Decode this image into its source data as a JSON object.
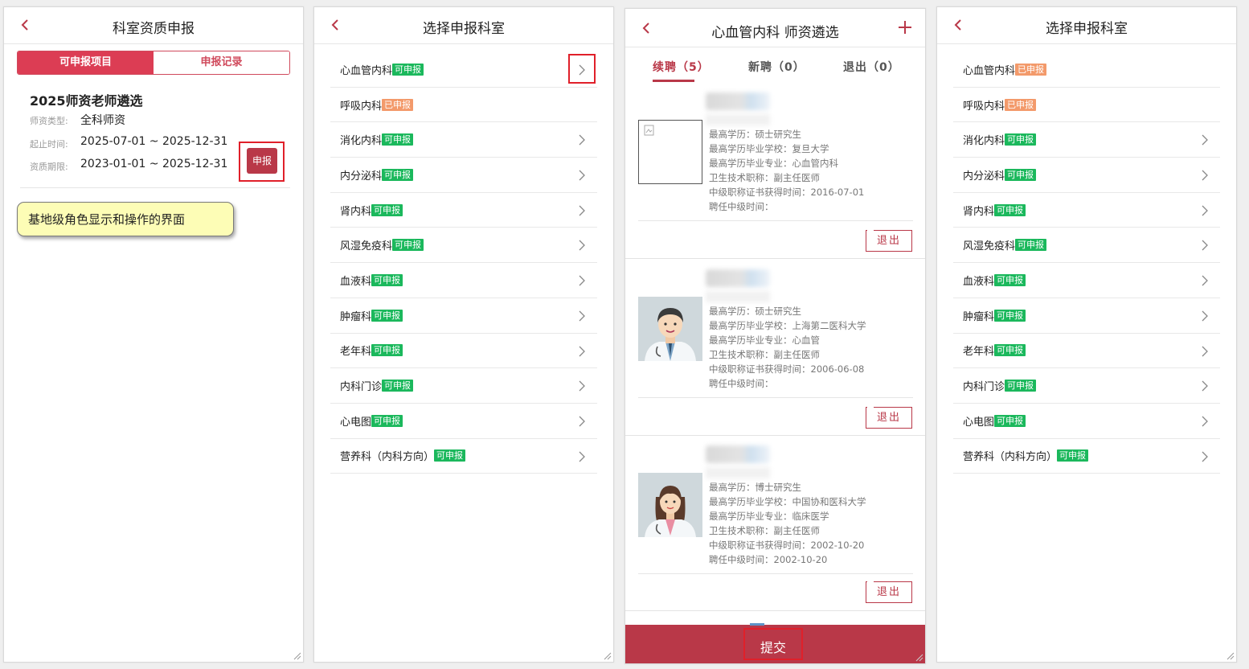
{
  "panel1": {
    "title": "科室资质申报",
    "tabs": [
      "可申报项目",
      "申报记录"
    ],
    "project": {
      "title": "2025师资老师遴选",
      "rows": [
        {
          "label": "师资类型:",
          "value": "全科师资"
        },
        {
          "label": "起止时间:",
          "value": "2025-07-01 ~ 2025-12-31"
        },
        {
          "label": "资质期限:",
          "value": "2023-01-01 ~ 2025-12-31"
        }
      ],
      "apply_label": "申报"
    },
    "note": "基地级角色显示和操作的界面"
  },
  "panel2": {
    "title": "选择申报科室",
    "items": [
      {
        "name": "心血管内科",
        "badge": "可申报",
        "status": "ok"
      },
      {
        "name": "呼吸内科",
        "badge": "已申报",
        "status": "done"
      },
      {
        "name": "消化内科",
        "badge": "可申报",
        "status": "ok"
      },
      {
        "name": "内分泌科",
        "badge": "可申报",
        "status": "ok"
      },
      {
        "name": "肾内科",
        "badge": "可申报",
        "status": "ok"
      },
      {
        "name": "风湿免疫科",
        "badge": "可申报",
        "status": "ok"
      },
      {
        "name": "血液科",
        "badge": "可申报",
        "status": "ok"
      },
      {
        "name": "肿瘤科",
        "badge": "可申报",
        "status": "ok"
      },
      {
        "name": "老年科",
        "badge": "可申报",
        "status": "ok"
      },
      {
        "name": "内科门诊",
        "badge": "可申报",
        "status": "ok"
      },
      {
        "name": "心电图",
        "badge": "可申报",
        "status": "ok"
      },
      {
        "name": "营养科（内科方向）",
        "badge": "可申报",
        "status": "ok"
      }
    ]
  },
  "panel3": {
    "title": "心血管内科 师资遴选",
    "tabs": [
      "续聘（5）",
      "新聘（0）",
      "退出（0）"
    ],
    "cards": [
      {
        "avatar": "broken-image-icon",
        "lines": [
          "最高学历：硕士研究生",
          "最高学历毕业学校：复旦大学",
          "最高学历毕业专业：心血管内科",
          "卫生技术职称：副主任医师",
          "中级职称证书获得时间：2016-07-01",
          "聘任中级时间："
        ],
        "exit_label": "退出"
      },
      {
        "avatar": "male-doctor-avatar",
        "lines": [
          "最高学历：硕士研究生",
          "最高学历毕业学校：上海第二医科大学",
          "最高学历毕业专业：心血管",
          "卫生技术职称：副主任医师",
          "中级职称证书获得时间：2006-06-08",
          "聘任中级时间："
        ],
        "exit_label": "退出"
      },
      {
        "avatar": "female-doctor-avatar",
        "lines": [
          "最高学历：博士研究生",
          "最高学历毕业学校：中国协和医科大学",
          "最高学历毕业专业：临床医学",
          "卫生技术职称：副主任医师",
          "中级职称证书获得时间：2002-10-20",
          "聘任中级时间：2002-10-20"
        ],
        "exit_label": "退出"
      }
    ],
    "submit_label": "提交"
  },
  "panel4": {
    "title": "选择申报科室",
    "items": [
      {
        "name": "心血管内科",
        "badge": "已申报",
        "status": "done"
      },
      {
        "name": "呼吸内科",
        "badge": "已申报",
        "status": "done"
      },
      {
        "name": "消化内科",
        "badge": "可申报",
        "status": "ok"
      },
      {
        "name": "内分泌科",
        "badge": "可申报",
        "status": "ok"
      },
      {
        "name": "肾内科",
        "badge": "可申报",
        "status": "ok"
      },
      {
        "name": "风湿免疫科",
        "badge": "可申报",
        "status": "ok"
      },
      {
        "name": "血液科",
        "badge": "可申报",
        "status": "ok"
      },
      {
        "name": "肿瘤科",
        "badge": "可申报",
        "status": "ok"
      },
      {
        "name": "老年科",
        "badge": "可申报",
        "status": "ok"
      },
      {
        "name": "内科门诊",
        "badge": "可申报",
        "status": "ok"
      },
      {
        "name": "心电图",
        "badge": "可申报",
        "status": "ok"
      },
      {
        "name": "营养科（内科方向）",
        "badge": "可申报",
        "status": "ok"
      }
    ]
  },
  "colors": {
    "brand": "#b93848",
    "tab_active": "#dc3d54",
    "badge_ok": "#1bb85c",
    "badge_done": "#f39a6b",
    "highlight": "#e0202a",
    "note_bg": "#fdfdb6"
  }
}
